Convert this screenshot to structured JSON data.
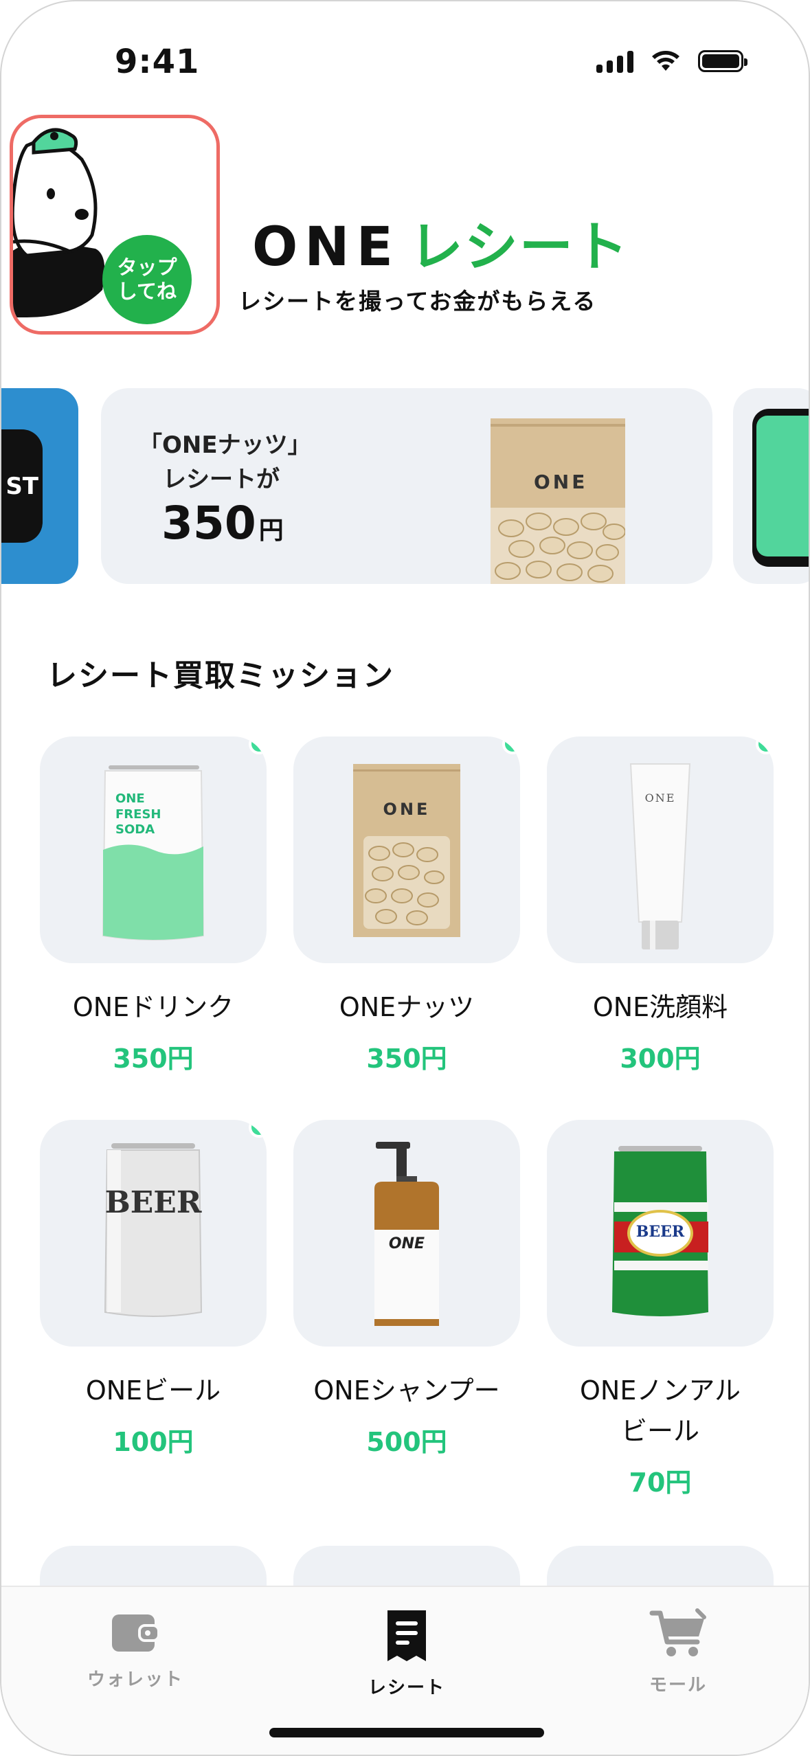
{
  "status_bar": {
    "time": "9:41"
  },
  "header": {
    "tap_bubble": "タップ\nしてね",
    "brand_one": "ONE",
    "brand_receipt": "レシート",
    "tagline": "レシートを撮ってお金がもらえる"
  },
  "banner": {
    "left_tag": "ST",
    "line1": "「ONEナッツ」",
    "line2": "レシートが",
    "amount": "350",
    "currency": "円",
    "bag_label": "ONE"
  },
  "missions": {
    "title": "レシート買取ミッション",
    "items": [
      {
        "name": "ONEドリンク",
        "price": "350円",
        "new": true,
        "product_text": "ONE\nFRESH\nSODA"
      },
      {
        "name": "ONEナッツ",
        "price": "350円",
        "new": true,
        "product_text": "ONE"
      },
      {
        "name": "ONE洗顔料",
        "price": "300円",
        "new": true,
        "product_text": "ONE"
      },
      {
        "name": "ONEビール",
        "price": "100円",
        "new": true,
        "product_text": "BEER"
      },
      {
        "name": "ONEシャンプー",
        "price": "500円",
        "new": false,
        "product_text": "ONE"
      },
      {
        "name": "ONEノンアル\nビール",
        "price": "70円",
        "new": false,
        "product_text": "BEER"
      }
    ]
  },
  "tabbar": {
    "tabs": [
      {
        "label": "ウォレット",
        "icon": "wallet-icon",
        "active": false
      },
      {
        "label": "レシート",
        "icon": "receipt-icon",
        "active": true
      },
      {
        "label": "モール",
        "icon": "cart-icon",
        "active": false
      }
    ]
  },
  "colors": {
    "accent_green": "#22b14c",
    "price_green": "#23c47c",
    "new_dot": "#3edc98",
    "highlight_border": "#ee6b65"
  }
}
